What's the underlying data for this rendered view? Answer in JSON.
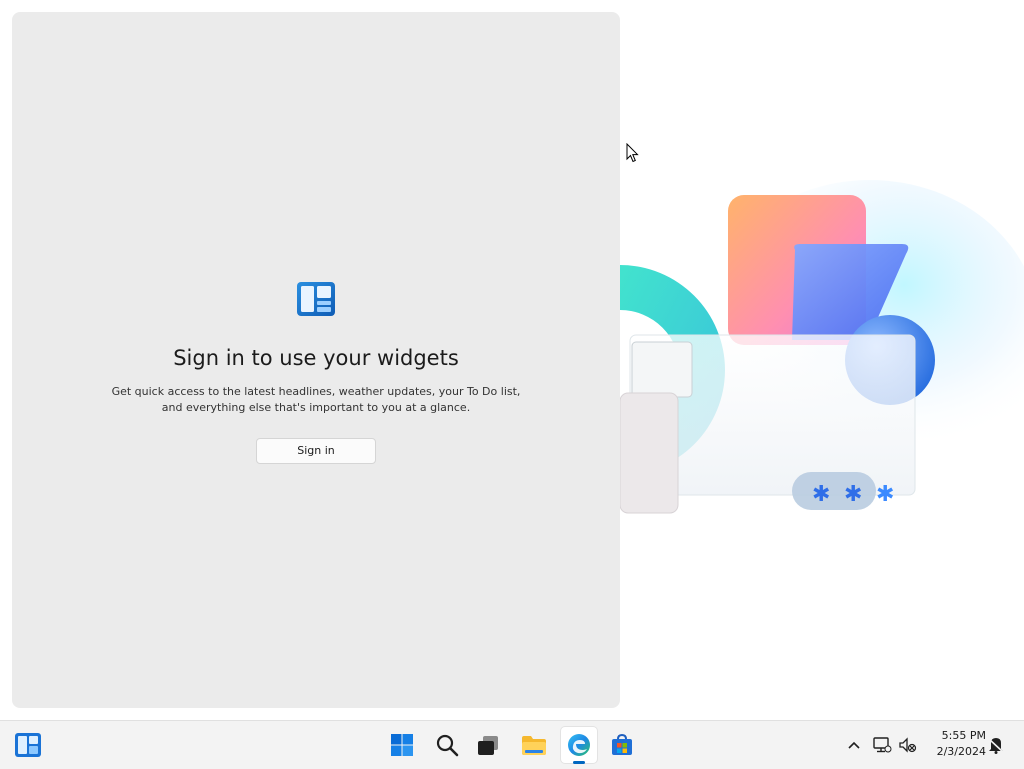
{
  "widgets": {
    "title": "Sign in to use your widgets",
    "description": "Get quick access to the latest headlines, weather updates, your To Do list, and everything else that's important to you at a glance.",
    "signin_label": "Sign in"
  },
  "taskbar": {
    "icons": [
      "widgets-icon",
      "start-icon",
      "search-icon",
      "task-view-icon",
      "file-explorer-icon",
      "edge-icon",
      "store-icon"
    ],
    "active_app": "edge",
    "accent": "#0067c0"
  },
  "tray": {
    "icons": [
      "chevron-up-icon",
      "network-icon",
      "volume-muted-icon",
      "notification-icon"
    ],
    "time": "5:55 PM",
    "date": "2/3/2024"
  }
}
